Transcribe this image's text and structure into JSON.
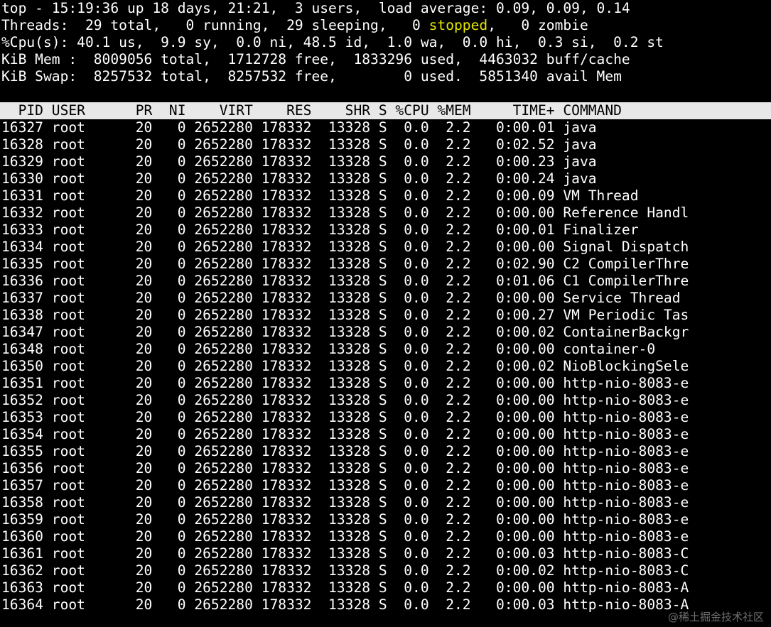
{
  "summary": {
    "line1": "top - 15:19:36 up 18 days, 21:21,  3 users,  load average: 0.09, 0.09, 0.14",
    "line2_pre": "Threads:  29 total,   0 running,  29 sleeping,   0 ",
    "line2_stopped": "stopped",
    "line2_post": ",   0 zombie",
    "line3": "%Cpu(s): 40.1 us,  9.9 sy,  0.0 ni, 48.5 id,  1.0 wa,  0.0 hi,  0.3 si,  0.2 st",
    "line4": "KiB Mem :  8009056 total,  1712728 free,  1833296 used,  4463032 buff/cache",
    "line5": "KiB Swap:  8257532 total,  8257532 free,        0 used.  5851340 avail Mem"
  },
  "table_header": "  PID USER      PR  NI    VIRT    RES    SHR S %CPU %MEM     TIME+ COMMAND",
  "rows": [
    "16327 root      20   0 2652280 178332  13328 S  0.0  2.2   0:00.01 java",
    "16328 root      20   0 2652280 178332  13328 S  0.0  2.2   0:02.52 java",
    "16329 root      20   0 2652280 178332  13328 S  0.0  2.2   0:00.23 java",
    "16330 root      20   0 2652280 178332  13328 S  0.0  2.2   0:00.24 java",
    "16331 root      20   0 2652280 178332  13328 S  0.0  2.2   0:00.09 VM Thread",
    "16332 root      20   0 2652280 178332  13328 S  0.0  2.2   0:00.00 Reference Handl",
    "16333 root      20   0 2652280 178332  13328 S  0.0  2.2   0:00.01 Finalizer",
    "16334 root      20   0 2652280 178332  13328 S  0.0  2.2   0:00.00 Signal Dispatch",
    "16335 root      20   0 2652280 178332  13328 S  0.0  2.2   0:02.90 C2 CompilerThre",
    "16336 root      20   0 2652280 178332  13328 S  0.0  2.2   0:01.06 C1 CompilerThre",
    "16337 root      20   0 2652280 178332  13328 S  0.0  2.2   0:00.00 Service Thread",
    "16338 root      20   0 2652280 178332  13328 S  0.0  2.2   0:00.27 VM Periodic Tas",
    "16347 root      20   0 2652280 178332  13328 S  0.0  2.2   0:00.02 ContainerBackgr",
    "16348 root      20   0 2652280 178332  13328 S  0.0  2.2   0:00.00 container-0",
    "16350 root      20   0 2652280 178332  13328 S  0.0  2.2   0:00.02 NioBlockingSele",
    "16351 root      20   0 2652280 178332  13328 S  0.0  2.2   0:00.00 http-nio-8083-e",
    "16352 root      20   0 2652280 178332  13328 S  0.0  2.2   0:00.00 http-nio-8083-e",
    "16353 root      20   0 2652280 178332  13328 S  0.0  2.2   0:00.00 http-nio-8083-e",
    "16354 root      20   0 2652280 178332  13328 S  0.0  2.2   0:00.00 http-nio-8083-e",
    "16355 root      20   0 2652280 178332  13328 S  0.0  2.2   0:00.00 http-nio-8083-e",
    "16356 root      20   0 2652280 178332  13328 S  0.0  2.2   0:00.00 http-nio-8083-e",
    "16357 root      20   0 2652280 178332  13328 S  0.0  2.2   0:00.00 http-nio-8083-e",
    "16358 root      20   0 2652280 178332  13328 S  0.0  2.2   0:00.00 http-nio-8083-e",
    "16359 root      20   0 2652280 178332  13328 S  0.0  2.2   0:00.00 http-nio-8083-e",
    "16360 root      20   0 2652280 178332  13328 S  0.0  2.2   0:00.00 http-nio-8083-e",
    "16361 root      20   0 2652280 178332  13328 S  0.0  2.2   0:00.03 http-nio-8083-C",
    "16362 root      20   0 2652280 178332  13328 S  0.0  2.2   0:00.02 http-nio-8083-C",
    "16363 root      20   0 2652280 178332  13328 S  0.0  2.2   0:00.00 http-nio-8083-A",
    "16364 root      20   0 2652280 178332  13328 S  0.0  2.2   0:00.03 http-nio-8083-A"
  ],
  "watermark": "@稀土掘金技术社区",
  "colors": {
    "background": "#000000",
    "foreground": "#ffffff",
    "stopped_highlight": "#e5e500",
    "header_bar": "#e8e8e8"
  }
}
